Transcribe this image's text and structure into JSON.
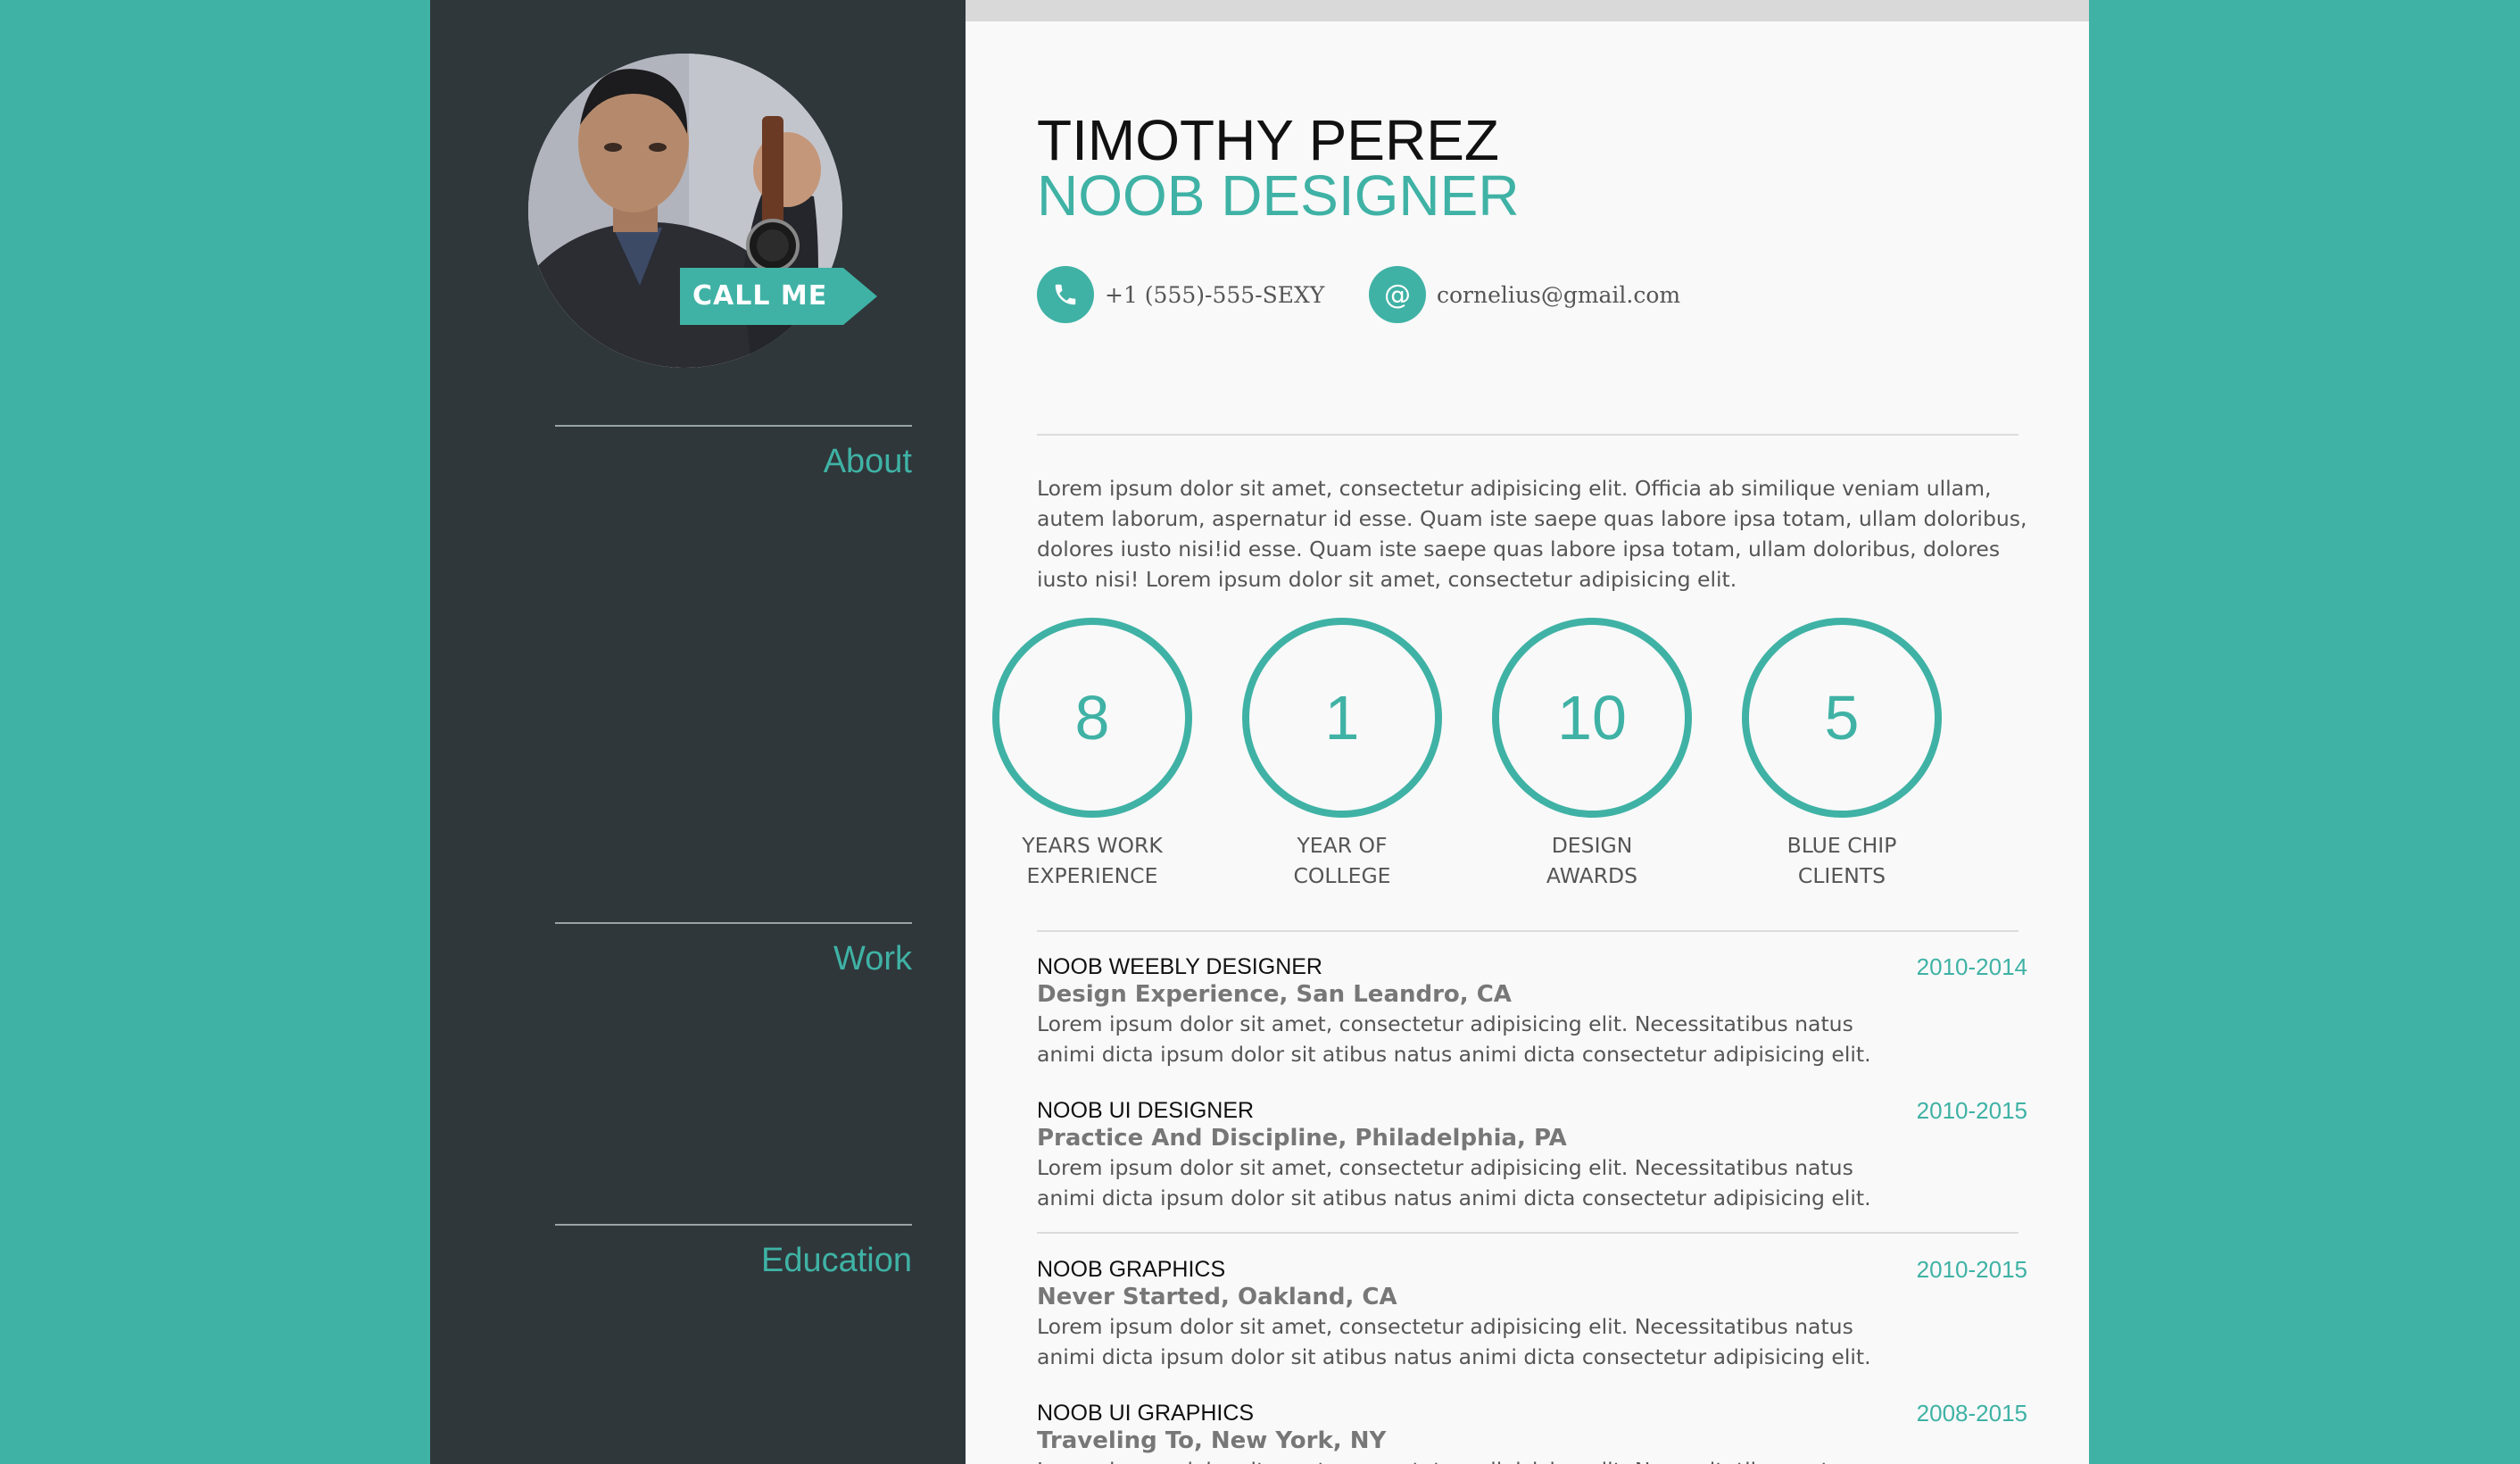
{
  "colors": {
    "accent": "#3fb2a5",
    "sidebar": "#2f373b",
    "background": "#3fb2a5",
    "main": "#f9f9f9"
  },
  "sidebar": {
    "call_me": "CALL ME",
    "sections": {
      "about": "About",
      "work": "Work",
      "education": "Education"
    }
  },
  "header": {
    "name": "TIMOTHY PEREZ",
    "role": "NOOB DESIGNER",
    "phone": "+1 (555)-555-SEXY",
    "phone_icon": "phone-icon",
    "email": "cornelius@gmail.com",
    "email_icon": "at-icon",
    "email_glyph": "@"
  },
  "about": {
    "text": "Lorem ipsum dolor sit amet, consectetur adipisicing elit. Officia ab similique veniam ullam, autem laborum, aspernatur id esse. Quam iste saepe quas labore ipsa totam, ullam doloribus, dolores iusto nisi!id esse. Quam iste saepe quas labore ipsa totam, ullam doloribus, dolores iusto nisi! Lorem ipsum dolor sit amet, consectetur adipisicing elit."
  },
  "stats": [
    {
      "value": "8",
      "line1": "YEARS WORK",
      "line2": "EXPERIENCE"
    },
    {
      "value": "1",
      "line1": "YEAR OF",
      "line2": "COLLEGE"
    },
    {
      "value": "10",
      "line1": "DESIGN",
      "line2": "AWARDS"
    },
    {
      "value": "5",
      "line1": "BLUE CHIP",
      "line2": "CLIENTS"
    }
  ],
  "work": [
    {
      "title": "NOOB WEEBLY DESIGNER",
      "subtitle": "Design Experience, San Leandro, CA",
      "description": "Lorem ipsum dolor sit amet, consectetur adipisicing elit. Necessitatibus natus animi dicta ipsum dolor sit atibus natus animi dicta consectetur adipisicing elit.",
      "years": "2010-2014"
    },
    {
      "title": "NOOB UI DESIGNER",
      "subtitle": "Practice And Discipline, Philadelphia, PA",
      "description": "Lorem ipsum dolor sit amet, consectetur adipisicing elit. Necessitatibus natus animi dicta ipsum dolor sit atibus natus animi dicta consectetur adipisicing elit.",
      "years": "2010-2015"
    }
  ],
  "education": [
    {
      "title": "NOOB GRAPHICS",
      "subtitle": "Never Started, Oakland, CA",
      "description": "Lorem ipsum dolor sit amet, consectetur adipisicing elit. Necessitatibus natus animi dicta ipsum dolor sit atibus natus animi dicta consectetur adipisicing elit.",
      "years": "2010-2015"
    },
    {
      "title": "NOOB UI GRAPHICS",
      "subtitle": "Traveling To, New York, NY",
      "description": "Lorem ipsum dolor sit amet, consectetur adipisicing elit. Necessitatibus natus animi dicta ipsum dolor sit atibus natus animi dicta consectetur adipisicing elit.",
      "years": "2008-2015"
    }
  ]
}
